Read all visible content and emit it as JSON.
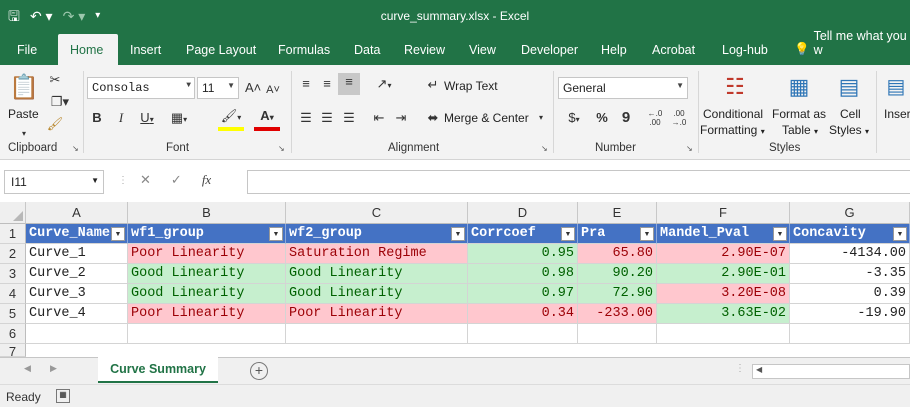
{
  "window": {
    "title": "curve_summary.xlsx  -  Excel"
  },
  "qat": {
    "save_icon": "save-icon",
    "undo_icon": "undo-icon",
    "redo_icon": "redo-icon",
    "customize_icon": "customize-icon"
  },
  "tabs": [
    "File",
    "Home",
    "Insert",
    "Page Layout",
    "Formulas",
    "Data",
    "Review",
    "View",
    "Developer",
    "Help",
    "Acrobat",
    "Log-hub",
    "Tell me what you w"
  ],
  "ribbon": {
    "clipboard": {
      "paste": "Paste",
      "label": "Clipboard"
    },
    "font": {
      "name": "Consolas",
      "size": "11",
      "label": "Font"
    },
    "alignment": {
      "wrap": "Wrap Text",
      "merge": "Merge & Center",
      "label": "Alignment"
    },
    "number": {
      "format": "General",
      "currency": "$",
      "percent": "%",
      "comma": "9",
      "label": "Number"
    },
    "styles": {
      "conditional_1": "Conditional",
      "conditional_2": "Formatting",
      "table_1": "Format as",
      "table_2": "Table",
      "cell_1": "Cell",
      "cell_2": "Styles",
      "label": "Styles"
    },
    "cells": {
      "insert": "Inser"
    }
  },
  "formula_bar": {
    "name_box": "I11",
    "fx": "fx",
    "formula": ""
  },
  "columns": [
    "A",
    "B",
    "C",
    "D",
    "E",
    "F",
    "G"
  ],
  "rows": [
    "1",
    "2",
    "3",
    "4",
    "5",
    "6",
    "7"
  ],
  "table": {
    "headers": [
      "Curve_Name",
      "wf1_group",
      "wf2_group",
      "Corrcoef",
      "Pra",
      "Mandel_Pval",
      "Concavity"
    ],
    "data": [
      [
        "Curve_1",
        "Poor Linearity",
        "Saturation Regime",
        "0.95",
        "65.80",
        "2.90E-07",
        "-4134.00"
      ],
      [
        "Curve_2",
        "Good Linearity",
        "Good Linearity",
        "0.98",
        "90.20",
        "2.90E-01",
        "-3.35"
      ],
      [
        "Curve_3",
        "Good Linearity",
        "Good Linearity",
        "0.97",
        "72.90",
        "3.20E-08",
        "0.39"
      ],
      [
        "Curve_4",
        "Poor Linearity",
        "Poor Linearity",
        "0.34",
        "-233.00",
        "3.63E-02",
        "-19.90"
      ]
    ],
    "fills": [
      [
        "none",
        "red",
        "red",
        "green",
        "red",
        "red",
        "none"
      ],
      [
        "none",
        "green",
        "green",
        "green",
        "green",
        "green",
        "none"
      ],
      [
        "none",
        "green",
        "green",
        "green",
        "green",
        "red",
        "none"
      ],
      [
        "none",
        "red",
        "red",
        "red",
        "red",
        "green",
        "none"
      ]
    ],
    "fill_colors": {
      "red_bg": "#ffc7ce",
      "red_text": "#9c0006",
      "green_bg": "#c6efce",
      "green_text": "#006100",
      "header_bg": "#4472c4"
    }
  },
  "sheets": {
    "active": "Curve Summary"
  },
  "status": {
    "text": "Ready"
  },
  "colors": {
    "accent": "#217346"
  }
}
